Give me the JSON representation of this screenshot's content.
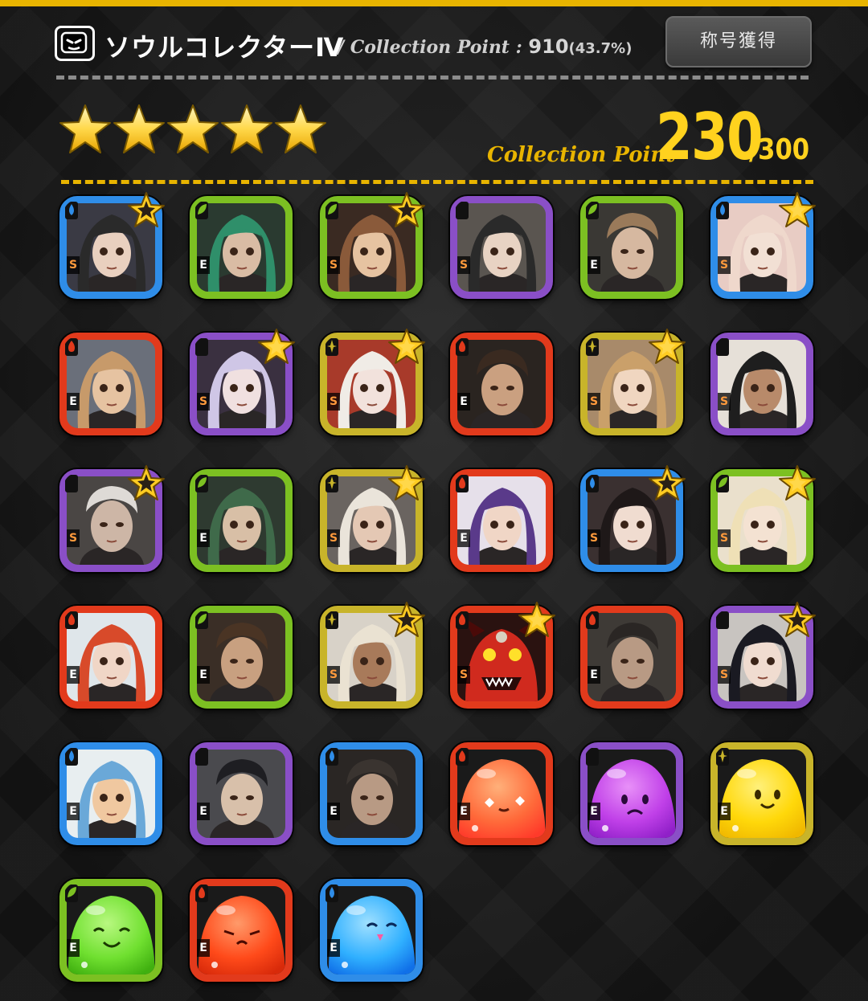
{
  "header": {
    "title": "ソウルコレクターⅣ",
    "collection_label": "/ Collection Point : ",
    "collection_value": "910",
    "collection_percent": "(43.7%)",
    "title_button": "称号獲得"
  },
  "rank": {
    "stars": 5,
    "label": "Collection Point",
    "value": "230",
    "max": "/300"
  },
  "colors": {
    "accent": "#e8b400",
    "water": "#2f8de8",
    "wood": "#7cc022",
    "fire": "#e23a1c",
    "dark": "#8a4fc7",
    "light": "#c8b42a"
  },
  "cards": [
    {
      "elem": "water",
      "rank": "S",
      "star": true,
      "type": "girl",
      "hair": "#2a2a2a",
      "skin": "#e9d0bf",
      "bg": "#3a3a44"
    },
    {
      "elem": "wood",
      "rank": "E",
      "star": false,
      "type": "girl",
      "hair": "#2f8f6a",
      "skin": "#d9bca4",
      "bg": "#2a3a30"
    },
    {
      "elem": "wood",
      "rank": "S",
      "star": true,
      "type": "girl",
      "hair": "#8a5a3a",
      "skin": "#e6c3a1",
      "bg": "#3a2a22"
    },
    {
      "elem": "dark",
      "rank": "S",
      "star": false,
      "type": "girl",
      "hair": "#2a2a2a",
      "skin": "#e8d3c3",
      "bg": "#5a5550"
    },
    {
      "elem": "wood",
      "rank": "E",
      "star": false,
      "type": "man",
      "hair": "#9a7a5a",
      "skin": "#d6b8a0",
      "bg": "#3a3834"
    },
    {
      "elem": "water",
      "rank": "S",
      "star": true,
      "type": "girl",
      "hair": "#efd8cc",
      "skin": "#f2e0d4",
      "bg": "#e8ccc4"
    },
    {
      "elem": "fire",
      "rank": "E",
      "star": false,
      "type": "girl",
      "hair": "#c79a6a",
      "skin": "#e6c3a1",
      "bg": "#6a6f7a"
    },
    {
      "elem": "dark",
      "rank": "S",
      "star": true,
      "type": "girl",
      "hair": "#cfc6e6",
      "skin": "#f0e0e0",
      "bg": "#3a3040"
    },
    {
      "elem": "light",
      "rank": "S",
      "star": true,
      "type": "girl",
      "hair": "#f0ece6",
      "skin": "#f2e2dc",
      "bg": "#a83a2a"
    },
    {
      "elem": "fire",
      "rank": "E",
      "star": false,
      "type": "man",
      "hair": "#3a2a20",
      "skin": "#caa080",
      "bg": "#2a2420"
    },
    {
      "elem": "light",
      "rank": "S",
      "star": true,
      "type": "girl",
      "hair": "#caa06a",
      "skin": "#f0d6c0",
      "bg": "#a88a6a"
    },
    {
      "elem": "dark",
      "rank": "S",
      "star": false,
      "type": "girl",
      "hair": "#1e1e1e",
      "skin": "#b88a6a",
      "bg": "#e6e0d8"
    },
    {
      "elem": "dark",
      "rank": "S",
      "star": true,
      "type": "man",
      "hair": "#dedad6",
      "skin": "#cdb6a6",
      "bg": "#4a4644"
    },
    {
      "elem": "wood",
      "rank": "E",
      "star": false,
      "type": "girl",
      "hair": "#3f6a4a",
      "skin": "#d8bfa6",
      "bg": "#2e3a30"
    },
    {
      "elem": "light",
      "rank": "S",
      "star": true,
      "type": "girl",
      "hair": "#eae4da",
      "skin": "#e4c8b4",
      "bg": "#6a6460"
    },
    {
      "elem": "fire",
      "rank": "E",
      "star": false,
      "type": "girl",
      "hair": "#5a3a8a",
      "skin": "#f0d6c6",
      "bg": "#e6e0ea"
    },
    {
      "elem": "water",
      "rank": "S",
      "star": true,
      "type": "girl",
      "hair": "#1e1818",
      "skin": "#f0dcd0",
      "bg": "#3a3030"
    },
    {
      "elem": "wood",
      "rank": "S",
      "star": true,
      "type": "girl",
      "hair": "#efe0b6",
      "skin": "#f4e2d2",
      "bg": "#eae0cc"
    },
    {
      "elem": "fire",
      "rank": "E",
      "star": false,
      "type": "girl",
      "hair": "#d84a2a",
      "skin": "#f0d6c6",
      "bg": "#dfe6ea"
    },
    {
      "elem": "wood",
      "rank": "E",
      "star": false,
      "type": "man",
      "hair": "#4a3424",
      "skin": "#c8a080",
      "bg": "#3a2e26"
    },
    {
      "elem": "light",
      "rank": "S",
      "star": true,
      "type": "girl",
      "hair": "#eae2d2",
      "skin": "#a87a5a",
      "bg": "#d8d2c8"
    },
    {
      "elem": "fire",
      "rank": "S",
      "star": true,
      "type": "demon",
      "hair": "#c8201a",
      "skin": "#d02a1e",
      "bg": "#2a1210"
    },
    {
      "elem": "fire",
      "rank": "E",
      "star": false,
      "type": "man",
      "hair": "#2a2624",
      "skin": "#b89a84",
      "bg": "#3e3a36"
    },
    {
      "elem": "dark",
      "rank": "S",
      "star": true,
      "type": "girl",
      "hair": "#1a1a22",
      "skin": "#f0dcd0",
      "bg": "#c8c4c0"
    },
    {
      "elem": "water",
      "rank": "E",
      "star": false,
      "type": "girl",
      "hair": "#6aa8d8",
      "skin": "#f0c8a0",
      "bg": "#e8eef0"
    },
    {
      "elem": "dark",
      "rank": "E",
      "star": false,
      "type": "man",
      "hair": "#1e1e22",
      "skin": "#d8c0aa",
      "bg": "#4a4a4e"
    },
    {
      "elem": "water",
      "rank": "E",
      "star": false,
      "type": "man",
      "hair": "#3a3430",
      "skin": "#b89a84",
      "bg": "#2a2624"
    },
    {
      "elem": "fire",
      "rank": "E",
      "star": false,
      "type": "slime",
      "hair": "#ff6a3a",
      "skin": "#ffb07a",
      "bg": "#ff3a2a",
      "mood": "sparkle"
    },
    {
      "elem": "dark",
      "rank": "E",
      "star": false,
      "type": "slime",
      "hair": "#c040e8",
      "skin": "#e890f8",
      "bg": "#9020c8",
      "mood": "sad"
    },
    {
      "elem": "light",
      "rank": "E",
      "star": false,
      "type": "slime",
      "hair": "#ffd80a",
      "skin": "#fff07a",
      "bg": "#f0b800",
      "mood": "happy"
    },
    {
      "elem": "wood",
      "rank": "E",
      "star": false,
      "type": "slime",
      "hair": "#70e030",
      "skin": "#b8f880",
      "bg": "#40b010",
      "mood": "smile"
    },
    {
      "elem": "fire",
      "rank": "E",
      "star": false,
      "type": "slime",
      "hair": "#ff4a1a",
      "skin": "#ff9a6a",
      "bg": "#d82a0a",
      "mood": "sleep"
    },
    {
      "elem": "water",
      "rank": "E",
      "star": false,
      "type": "slime",
      "hair": "#30b0ff",
      "skin": "#a0e0ff",
      "bg": "#1070e8",
      "mood": "cute"
    }
  ]
}
